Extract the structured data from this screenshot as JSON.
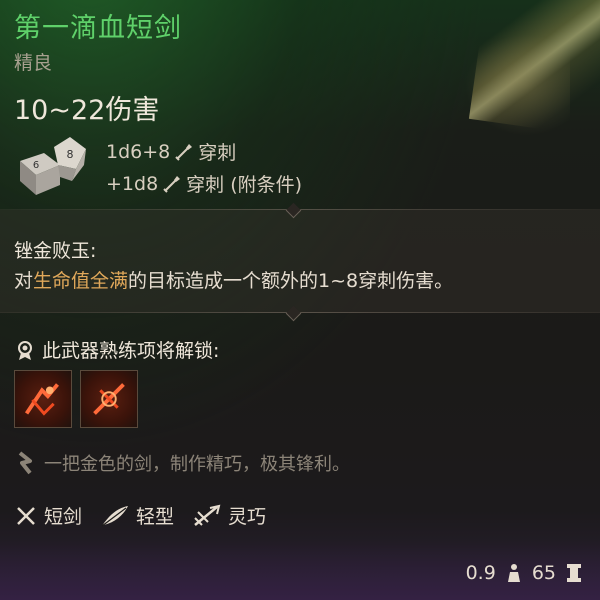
{
  "item": {
    "name": "第一滴血短剑",
    "rarity": "精良",
    "rarity_color": "#5fd16a",
    "damage": "10~22伤害"
  },
  "dice": [
    {
      "roll": "1d6+8",
      "type": "穿刺",
      "icon": "piercing-icon"
    },
    {
      "roll": "+1d8",
      "type": "穿刺 (附条件)",
      "icon": "piercing-icon"
    }
  ],
  "passive": {
    "name": "锉金败玉:",
    "prefix": "对",
    "highlight": "生命值全满",
    "suffix": "的目标造成一个额外的",
    "dice": "1~8",
    "tail": "穿刺伤害。",
    "highlight_color": "#e0a85a"
  },
  "proficiency": {
    "header": "此武器熟练项将解锁:",
    "icons": [
      "weapon-action-icon",
      "weapon-action-icon"
    ]
  },
  "flavor": "一把金色的剑，制作精巧，极其锋利。",
  "tags": [
    {
      "label": "短剑",
      "icon": "short-sword-icon"
    },
    {
      "label": "轻型",
      "icon": "feather-icon"
    },
    {
      "label": "灵巧",
      "icon": "finesse-icon"
    }
  ],
  "footer": {
    "weight": "0.9",
    "price": "65"
  }
}
